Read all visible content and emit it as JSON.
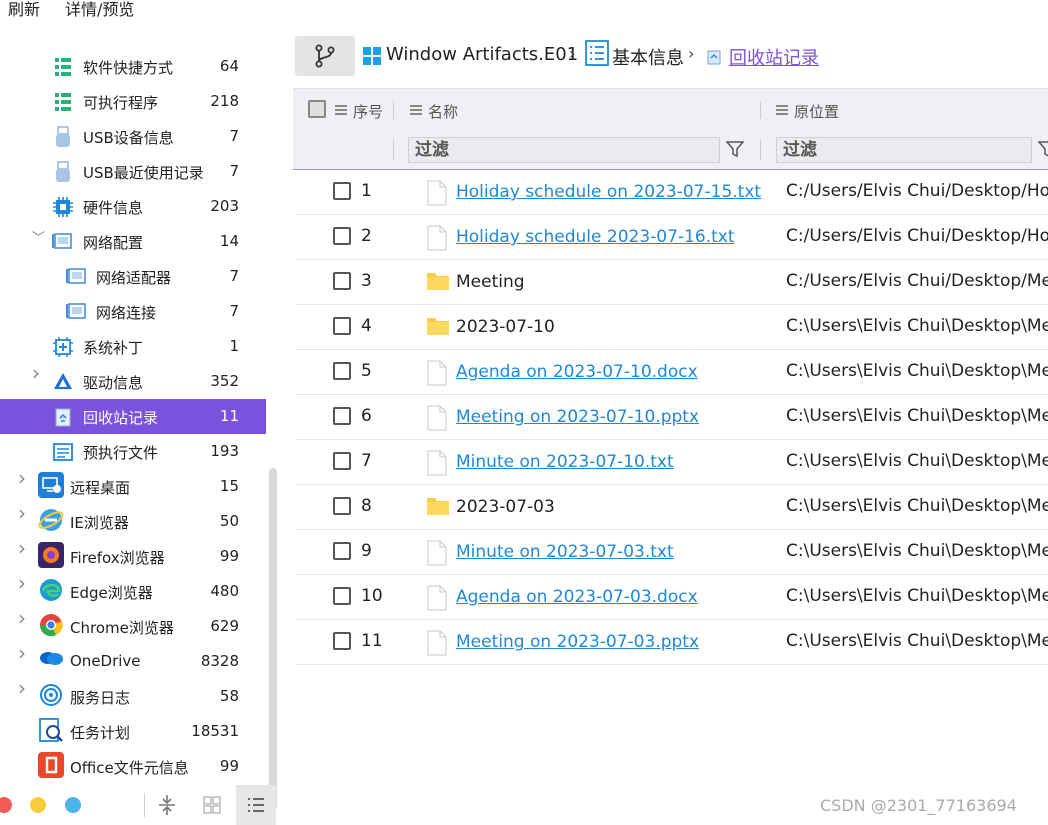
{
  "menu": {
    "refresh": "刷新",
    "details": "详情/预览"
  },
  "sidebar": {
    "items": [
      {
        "label": "软件快捷方式",
        "count": "64"
      },
      {
        "label": "可执行程序",
        "count": "218"
      },
      {
        "label": "USB设备信息",
        "count": "7"
      },
      {
        "label": "USB最近使用记录",
        "count": "7"
      },
      {
        "label": "硬件信息",
        "count": "203"
      },
      {
        "label": "网络配置",
        "count": "14"
      },
      {
        "label": "网络适配器",
        "count": "7"
      },
      {
        "label": "网络连接",
        "count": "7"
      },
      {
        "label": "系统补丁",
        "count": "1"
      },
      {
        "label": "驱动信息",
        "count": "352"
      },
      {
        "label": "回收站记录",
        "count": "11"
      },
      {
        "label": "预执行文件",
        "count": "193"
      },
      {
        "label": "远程桌面",
        "count": "15"
      },
      {
        "label": "IE浏览器",
        "count": "50"
      },
      {
        "label": "Firefox浏览器",
        "count": "99"
      },
      {
        "label": "Edge浏览器",
        "count": "480"
      },
      {
        "label": "Chrome浏览器",
        "count": "629"
      },
      {
        "label": "OneDrive",
        "count": "8328"
      },
      {
        "label": "服务日志",
        "count": "58"
      },
      {
        "label": "任务计划",
        "count": "18531"
      },
      {
        "label": "Office文件元信息",
        "count": "99"
      }
    ],
    "active_index": 10,
    "accent": "#7b52dc"
  },
  "breadcrumb": {
    "evidence": "Window Artifacts.E01",
    "section": "基本信息",
    "current": "回收站记录"
  },
  "table": {
    "headers": {
      "index": "序号",
      "name": "名称",
      "location": "原位置"
    },
    "filter_placeholder": "过滤",
    "rows": [
      {
        "index": "1",
        "name": "Holiday schedule on 2023-07-15.txt",
        "type": "file",
        "location": "C:/Users/Elvis Chui/Desktop/Holid..."
      },
      {
        "index": "2",
        "name": "Holiday schedule 2023-07-16.txt",
        "type": "file",
        "location": "C:/Users/Elvis Chui/Desktop/Holid..."
      },
      {
        "index": "3",
        "name": "Meeting",
        "type": "folder",
        "location": "C:/Users/Elvis Chui/Desktop/Meeti"
      },
      {
        "index": "4",
        "name": "2023-07-10",
        "type": "folder",
        "location": "C:\\Users\\Elvis Chui\\Desktop\\Meeti"
      },
      {
        "index": "5",
        "name": "Agenda on 2023-07-10.docx",
        "type": "file",
        "location": "C:\\Users\\Elvis Chui\\Desktop\\Meeti"
      },
      {
        "index": "6",
        "name": "Meeting on 2023-07-10.pptx",
        "type": "file",
        "location": "C:\\Users\\Elvis Chui\\Desktop\\Meeti"
      },
      {
        "index": "7",
        "name": "Minute on 2023-07-10.txt",
        "type": "file",
        "location": "C:\\Users\\Elvis Chui\\Desktop\\Meeti"
      },
      {
        "index": "8",
        "name": "2023-07-03",
        "type": "folder",
        "location": "C:\\Users\\Elvis Chui\\Desktop\\Meeti"
      },
      {
        "index": "9",
        "name": "Minute on 2023-07-03.txt",
        "type": "file",
        "location": "C:\\Users\\Elvis Chui\\Desktop\\Meeti"
      },
      {
        "index": "10",
        "name": "Agenda on 2023-07-03.docx",
        "type": "file",
        "location": "C:\\Users\\Elvis Chui\\Desktop\\Meeti"
      },
      {
        "index": "11",
        "name": "Meeting on 2023-07-03.pptx",
        "type": "file",
        "location": "C:\\Users\\Elvis Chui\\Desktop\\Meeti"
      }
    ]
  },
  "watermark": "CSDN @2301_77163694"
}
